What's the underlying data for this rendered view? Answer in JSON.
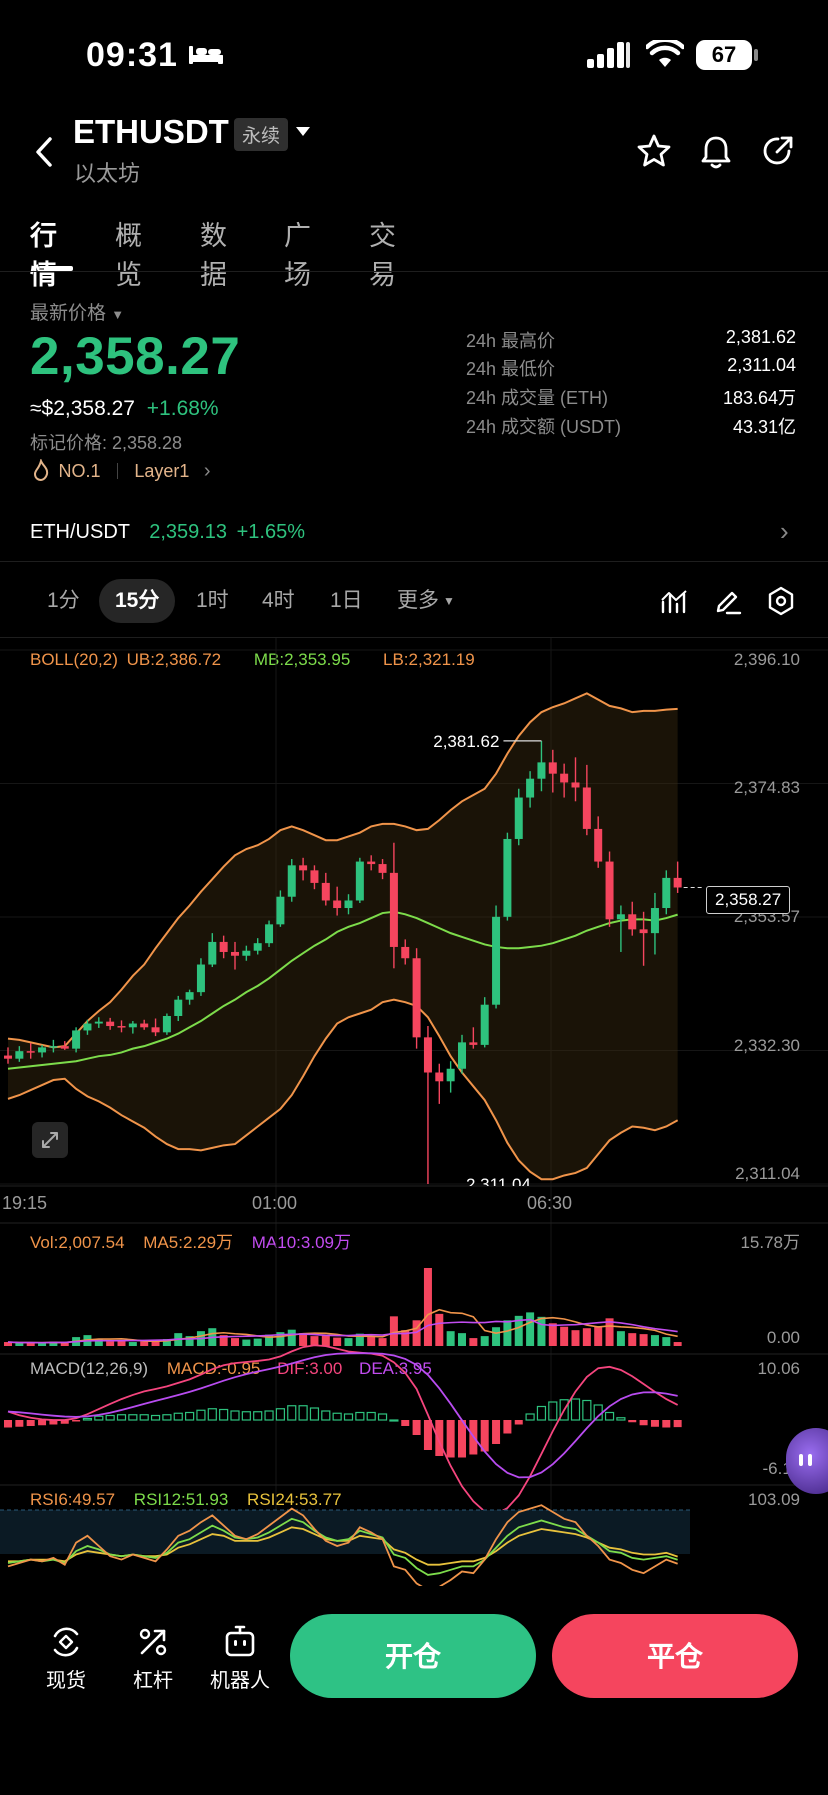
{
  "status_bar": {
    "time": "09:31",
    "battery": "67"
  },
  "header": {
    "symbol": "ETHUSDT",
    "contract_type": "永续",
    "subtitle": "以太坊"
  },
  "tabs": [
    "行情",
    "概览",
    "数据",
    "广场",
    "交易"
  ],
  "price_block": {
    "label": "最新价格",
    "last_price": "2,358.27",
    "usd_price": "≈$2,358.27",
    "change": "+1.68%",
    "mark_price": "标记价格: 2,358.28",
    "rank": "NO.1",
    "category": "Layer1"
  },
  "stats": [
    {
      "label": "24h 最高价",
      "value": "2,381.62"
    },
    {
      "label": "24h 最低价",
      "value": "2,311.04"
    },
    {
      "label": "24h 成交量 (ETH)",
      "value": "183.64万"
    },
    {
      "label": "24h 成交额 (USDT)",
      "value": "43.31亿"
    }
  ],
  "spot_row": {
    "pair": "ETH/USDT",
    "price": "2,359.13",
    "change": "+1.65%"
  },
  "intervals": [
    "1分",
    "15分",
    "1时",
    "4时",
    "1日",
    "更多"
  ],
  "active_interval": "15分",
  "colors": {
    "up": "#2ec27e",
    "down": "#f5455e",
    "boll_ub": "#f0944a",
    "boll_mb": "#7ddc4b",
    "macd_dif": "#f5457e",
    "macd_dea": "#b84cf0"
  },
  "chart_legends": {
    "boll": {
      "name": "BOLL(20,2)",
      "ub": "UB:2,386.72",
      "mb": "MB:2,353.95",
      "lb": "LB:2,321.19"
    },
    "vol": {
      "vol": "Vol:2,007.54",
      "ma5": "MA5:2.29万",
      "ma10": "MA10:3.09万"
    },
    "macd": {
      "name": "MACD(12,26,9)",
      "macd": "MACD:-0.95",
      "dif": "DIF:3.00",
      "dea": "DEA:3.95"
    },
    "rsi": {
      "rsi6": "RSI6:49.57",
      "rsi12": "RSI12:51.93",
      "rsi24": "RSI24:53.77"
    }
  },
  "axis_labels": {
    "price": [
      "2,396.10",
      "2,374.83",
      "2,353.57",
      "2,332.30",
      "2,311.04"
    ],
    "current_price_tag": "2,358.27",
    "high_marker": "2,381.62",
    "low_marker": "2,311.04",
    "time": [
      "19:15",
      "01:00",
      "06:30"
    ],
    "vol": [
      "15.78万",
      "0.00"
    ],
    "macd": [
      "10.06",
      "-6.11"
    ],
    "rsi": [
      "103.09"
    ]
  },
  "chart_data": {
    "type": "candlestick",
    "ylim": [
      2311.04,
      2396.1
    ],
    "candles": [
      [
        2331.5,
        2332.8,
        2330.2,
        2331.0
      ],
      [
        2331.0,
        2333.0,
        2330.5,
        2332.2
      ],
      [
        2332.2,
        2333.5,
        2331.0,
        2332.0
      ],
      [
        2332.0,
        2333.2,
        2331.2,
        2332.8
      ],
      [
        2332.8,
        2334.0,
        2332.0,
        2333.0
      ],
      [
        2333.0,
        2333.8,
        2332.4,
        2332.6
      ],
      [
        2332.6,
        2336.0,
        2332.0,
        2335.5
      ],
      [
        2335.5,
        2337.2,
        2334.8,
        2336.6
      ],
      [
        2336.6,
        2337.6,
        2335.9,
        2336.9
      ],
      [
        2336.9,
        2337.5,
        2335.6,
        2336.2
      ],
      [
        2336.2,
        2337.1,
        2335.2,
        2336.0
      ],
      [
        2336.0,
        2337.0,
        2335.0,
        2336.6
      ],
      [
        2336.6,
        2337.2,
        2335.6,
        2336.0
      ],
      [
        2336.0,
        2337.4,
        2334.6,
        2335.2
      ],
      [
        2335.2,
        2338.2,
        2334.8,
        2337.8
      ],
      [
        2337.8,
        2341.0,
        2337.0,
        2340.4
      ],
      [
        2340.4,
        2342.0,
        2339.6,
        2341.6
      ],
      [
        2341.6,
        2347.0,
        2341.0,
        2346.0
      ],
      [
        2346.0,
        2351.0,
        2345.6,
        2349.6
      ],
      [
        2349.6,
        2350.6,
        2347.0,
        2348.0
      ],
      [
        2348.0,
        2349.6,
        2345.2,
        2347.4
      ],
      [
        2347.4,
        2349.0,
        2346.6,
        2348.2
      ],
      [
        2348.2,
        2350.2,
        2347.6,
        2349.4
      ],
      [
        2349.4,
        2353.0,
        2348.8,
        2352.4
      ],
      [
        2352.4,
        2357.8,
        2352.0,
        2356.8
      ],
      [
        2356.8,
        2362.8,
        2356.0,
        2361.8
      ],
      [
        2361.8,
        2363.0,
        2359.4,
        2361.0
      ],
      [
        2361.0,
        2361.8,
        2358.0,
        2359.0
      ],
      [
        2359.0,
        2360.6,
        2355.4,
        2356.2
      ],
      [
        2356.2,
        2358.4,
        2353.8,
        2355.0
      ],
      [
        2355.0,
        2357.2,
        2354.0,
        2356.2
      ],
      [
        2356.2,
        2363.0,
        2355.8,
        2362.4
      ],
      [
        2362.4,
        2363.4,
        2361.0,
        2362.0
      ],
      [
        2362.0,
        2362.8,
        2359.6,
        2360.6
      ],
      [
        2360.6,
        2365.4,
        2345.4,
        2348.8
      ],
      [
        2348.8,
        2350.0,
        2346.0,
        2347.0
      ],
      [
        2347.0,
        2348.6,
        2332.6,
        2334.4
      ],
      [
        2334.4,
        2336.2,
        2311.04,
        2328.8
      ],
      [
        2328.8,
        2330.2,
        2323.8,
        2327.4
      ],
      [
        2327.4,
        2330.6,
        2325.6,
        2329.4
      ],
      [
        2329.4,
        2334.8,
        2328.6,
        2333.6
      ],
      [
        2333.6,
        2336.0,
        2332.6,
        2333.2
      ],
      [
        2333.2,
        2340.8,
        2332.8,
        2339.6
      ],
      [
        2339.6,
        2355.4,
        2339.0,
        2353.6
      ],
      [
        2353.6,
        2367.0,
        2353.0,
        2366.0
      ],
      [
        2366.0,
        2374.0,
        2365.0,
        2372.6
      ],
      [
        2372.6,
        2376.8,
        2371.0,
        2375.6
      ],
      [
        2375.6,
        2381.62,
        2373.6,
        2378.2
      ],
      [
        2378.2,
        2380.2,
        2373.4,
        2376.4
      ],
      [
        2376.4,
        2378.0,
        2372.6,
        2375.0
      ],
      [
        2375.0,
        2379.0,
        2372.0,
        2374.2
      ],
      [
        2374.2,
        2377.8,
        2366.6,
        2367.6
      ],
      [
        2367.6,
        2369.6,
        2361.4,
        2362.4
      ],
      [
        2362.4,
        2364.0,
        2352.0,
        2353.2
      ],
      [
        2353.2,
        2355.4,
        2348.0,
        2354.0
      ],
      [
        2354.0,
        2356.0,
        2350.6,
        2351.6
      ],
      [
        2351.6,
        2354.4,
        2345.8,
        2351.0
      ],
      [
        2351.0,
        2357.4,
        2347.6,
        2355.0
      ],
      [
        2355.0,
        2361.0,
        2354.0,
        2359.8
      ],
      [
        2359.8,
        2362.4,
        2357.4,
        2358.27
      ]
    ],
    "boll_ub": [
      2334.2,
      2334.0,
      2333.6,
      2333.2,
      2332.8,
      2333.0,
      2335.0,
      2337.0,
      2338.6,
      2340.0,
      2342.0,
      2344.2,
      2346.0,
      2348.6,
      2351.0,
      2353.4,
      2355.4,
      2357.6,
      2359.6,
      2361.6,
      2363.4,
      2364.4,
      2365.0,
      2366.0,
      2367.4,
      2368.0,
      2367.4,
      2366.6,
      2365.8,
      2365.8,
      2366.4,
      2367.0,
      2368.0,
      2368.4,
      2368.4,
      2368.0,
      2367.4,
      2367.6,
      2369.0,
      2370.6,
      2372.0,
      2373.0,
      2374.0,
      2376.4,
      2379.6,
      2382.4,
      2384.6,
      2386.2,
      2387.0,
      2387.6,
      2388.4,
      2389.2,
      2388.2,
      2387.2,
      2386.8,
      2386.2,
      2386.4,
      2386.4,
      2386.6,
      2386.72
    ],
    "boll_mb": [
      2329.4,
      2329.6,
      2329.8,
      2330.0,
      2330.2,
      2330.4,
      2330.6,
      2331.0,
      2331.4,
      2331.6,
      2332.0,
      2332.6,
      2333.0,
      2333.6,
      2334.2,
      2335.0,
      2336.0,
      2337.0,
      2338.2,
      2339.4,
      2340.4,
      2341.6,
      2342.6,
      2343.8,
      2345.2,
      2346.6,
      2347.8,
      2349.0,
      2350.0,
      2351.2,
      2352.0,
      2352.6,
      2353.4,
      2354.2,
      2354.4,
      2354.0,
      2353.4,
      2352.6,
      2351.8,
      2351.0,
      2350.4,
      2349.8,
      2349.2,
      2348.8,
      2348.6,
      2348.6,
      2348.8,
      2349.0,
      2349.4,
      2350.0,
      2350.6,
      2351.4,
      2352.0,
      2352.6,
      2353.0,
      2353.2,
      2353.2,
      2353.0,
      2353.4,
      2353.95
    ],
    "boll_lb": [
      2324.6,
      2325.2,
      2326.0,
      2326.8,
      2327.6,
      2327.8,
      2326.2,
      2325.0,
      2324.2,
      2323.2,
      2322.0,
      2321.0,
      2320.0,
      2318.6,
      2317.4,
      2316.6,
      2316.6,
      2316.4,
      2316.8,
      2317.2,
      2317.4,
      2318.8,
      2320.2,
      2321.6,
      2323.0,
      2325.2,
      2328.2,
      2331.4,
      2334.2,
      2336.6,
      2337.6,
      2338.2,
      2338.8,
      2340.0,
      2340.4,
      2340.0,
      2339.4,
      2337.6,
      2334.6,
      2331.4,
      2328.8,
      2326.6,
      2324.4,
      2321.2,
      2317.6,
      2314.8,
      2313.0,
      2311.8,
      2311.8,
      2312.4,
      2312.8,
      2313.6,
      2315.8,
      2318.0,
      2319.2,
      2320.2,
      2320.0,
      2319.6,
      2320.2,
      2321.19
    ],
    "volume": [
      0.8,
      0.6,
      0.7,
      0.6,
      0.9,
      0.7,
      1.8,
      2.2,
      1.4,
      0.9,
      1.0,
      0.8,
      0.9,
      1.1,
      1.4,
      2.6,
      2.0,
      3.0,
      3.6,
      2.2,
      1.6,
      1.3,
      1.5,
      2.3,
      2.8,
      3.3,
      2.6,
      2.0,
      2.1,
      1.7,
      1.6,
      2.5,
      1.9,
      1.6,
      6.0,
      3.2,
      5.2,
      15.78,
      6.5,
      3.0,
      2.6,
      1.6,
      2.0,
      3.8,
      5.2,
      6.1,
      6.8,
      5.9,
      4.6,
      3.9,
      3.2,
      3.6,
      4.0,
      5.6,
      3.0,
      2.6,
      2.4,
      2.2,
      1.8,
      0.8
    ],
    "macd_hist": [
      -1.0,
      -0.9,
      -0.8,
      -0.7,
      -0.6,
      -0.5,
      -0.2,
      0.2,
      0.5,
      0.6,
      0.7,
      0.7,
      0.7,
      0.6,
      0.7,
      0.9,
      1.0,
      1.3,
      1.5,
      1.4,
      1.2,
      1.1,
      1.1,
      1.2,
      1.5,
      1.9,
      1.9,
      1.6,
      1.2,
      0.9,
      0.8,
      1.0,
      1.0,
      0.8,
      0.0,
      -0.8,
      -2.0,
      -4.0,
      -4.8,
      -5.0,
      -5.0,
      -4.6,
      -4.2,
      -3.2,
      -1.8,
      -0.6,
      0.8,
      1.8,
      2.4,
      2.7,
      2.8,
      2.6,
      2.0,
      1.0,
      0.3,
      -0.3,
      -0.7,
      -0.9,
      -1.0,
      -0.95
    ],
    "rsi6": [
      48,
      50,
      52,
      51,
      53,
      49,
      62,
      66,
      60,
      54,
      52,
      55,
      53,
      51,
      58,
      66,
      69,
      74,
      78,
      72,
      66,
      64,
      67,
      72,
      77,
      82,
      78,
      70,
      63,
      60,
      62,
      71,
      68,
      64,
      48,
      46,
      38,
      34,
      36,
      40,
      45,
      44,
      52,
      64,
      74,
      80,
      82,
      84,
      80,
      76,
      74,
      66,
      60,
      52,
      50,
      46,
      44,
      48,
      52,
      49.57
    ],
    "rsi12": [
      50,
      51,
      52,
      51,
      52,
      50,
      57,
      60,
      58,
      55,
      54,
      55,
      54,
      53,
      56,
      62,
      64,
      68,
      72,
      69,
      65,
      64,
      65,
      68,
      72,
      76,
      74,
      69,
      65,
      63,
      64,
      69,
      67,
      65,
      55,
      53,
      47,
      43,
      44,
      46,
      48,
      48,
      52,
      59,
      66,
      71,
      73,
      75,
      73,
      71,
      70,
      66,
      62,
      57,
      56,
      53,
      52,
      53,
      54,
      51.93
    ],
    "rsi24": [
      51,
      51,
      52,
      52,
      52,
      51,
      55,
      57,
      56,
      55,
      54,
      55,
      54,
      54,
      55,
      59,
      61,
      64,
      67,
      66,
      63,
      63,
      63,
      65,
      68,
      71,
      70,
      67,
      64,
      63,
      63,
      66,
      65,
      64,
      58,
      56,
      52,
      49,
      49,
      50,
      51,
      51,
      53,
      57,
      62,
      66,
      68,
      70,
      69,
      68,
      67,
      65,
      62,
      59,
      58,
      56,
      55,
      55,
      56,
      53.77
    ]
  },
  "bottom_nav": [
    {
      "label": "现货",
      "icon": "spot-icon"
    },
    {
      "label": "杠杆",
      "icon": "leverage-icon"
    },
    {
      "label": "机器人",
      "icon": "robot-icon"
    }
  ],
  "actions": {
    "open": "开仓",
    "close": "平仓"
  }
}
